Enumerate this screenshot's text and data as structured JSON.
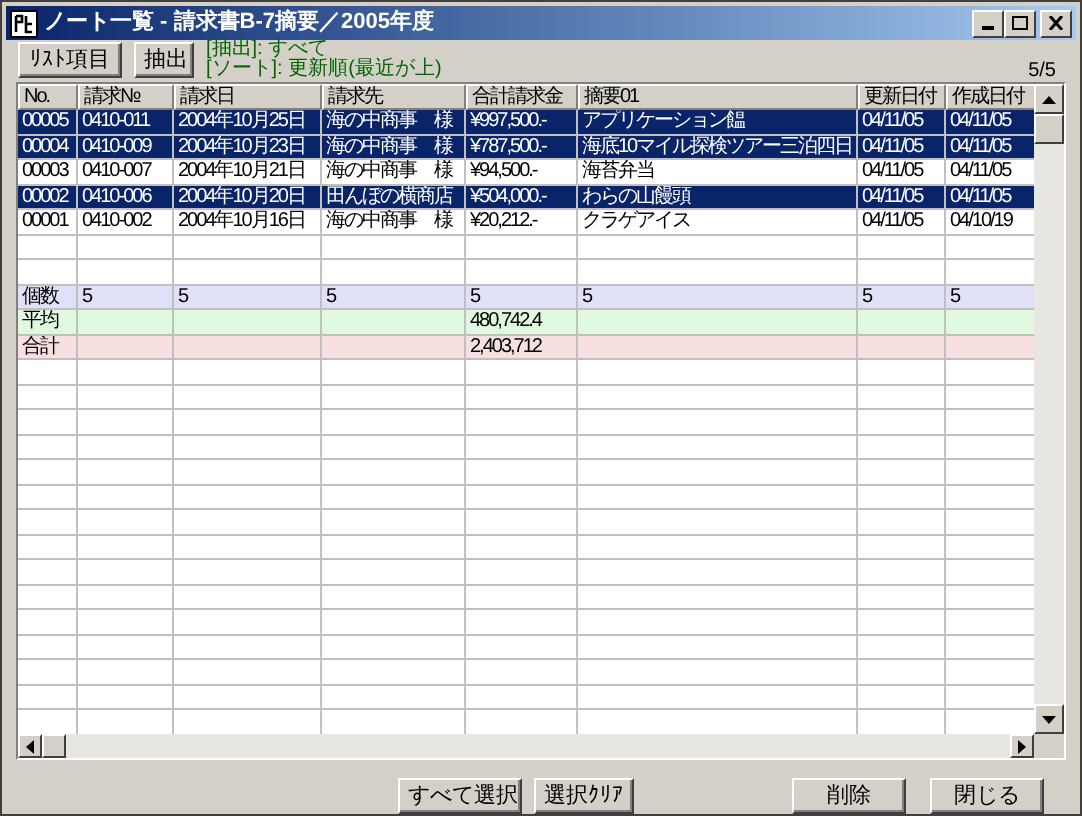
{
  "window": {
    "title": "ノート一覧 - 請求書B-7摘要／2005年度"
  },
  "toolbar": {
    "buttons": [
      "ﾘｽﾄ項目",
      "抽出"
    ],
    "filter": "[抽出]: すべて",
    "sort": "[ソート]:  更新順(最近が上)",
    "count": "5/5"
  },
  "table": {
    "columns": [
      "No.",
      "請求№",
      "請求日",
      "請求先",
      "合計請求金",
      "摘要01",
      "更新日付",
      "作成日付"
    ],
    "rows": [
      {
        "selected": true,
        "cells": [
          "00005",
          "0410-011",
          "2004年10月25日",
          "海の中商事　様",
          "¥997,500.-",
          "アプリケーション饂",
          "04/11/05",
          "04/11/05"
        ]
      },
      {
        "selected": true,
        "cells": [
          "00004",
          "0410-009",
          "2004年10月23日",
          "海の中商事　様",
          "¥787,500.-",
          "海底10マイル探検ツアー三泊四日",
          "04/11/05",
          "04/11/05"
        ]
      },
      {
        "selected": false,
        "cells": [
          "00003",
          "0410-007",
          "2004年10月21日",
          "海の中商事　様",
          "¥94,500.-",
          "海苔弁当",
          "04/11/05",
          "04/11/05"
        ]
      },
      {
        "selected": true,
        "cells": [
          "00002",
          "0410-006",
          "2004年10月20日",
          "田んぼの横商店",
          "¥504,000.-",
          "わらの山饅頭",
          "04/11/05",
          "04/11/05"
        ]
      },
      {
        "selected": false,
        "cells": [
          "00001",
          "0410-002",
          "2004年10月16日",
          "海の中商事　様",
          "¥20,212.-",
          "クラゲアイス",
          "04/11/05",
          "04/10/19"
        ]
      }
    ],
    "summary_rows": [
      {
        "color": "#e0e0f8",
        "cells": [
          "個数",
          "5",
          "5",
          "5",
          "5",
          "5",
          "5",
          "5"
        ]
      },
      {
        "color": "#e0f8e0",
        "cells": [
          "平均",
          null,
          null,
          null,
          "480,742.4",
          null,
          null,
          null
        ]
      },
      {
        "color": "#f8e0e0",
        "cells": [
          "合計",
          null,
          null,
          null,
          "2,403,712",
          null,
          null,
          null
        ]
      }
    ]
  },
  "selection_buttons": [
    "すべて選択",
    "選択ｸﾘｱ"
  ],
  "action_buttons": [
    "削除",
    "閉じる"
  ]
}
